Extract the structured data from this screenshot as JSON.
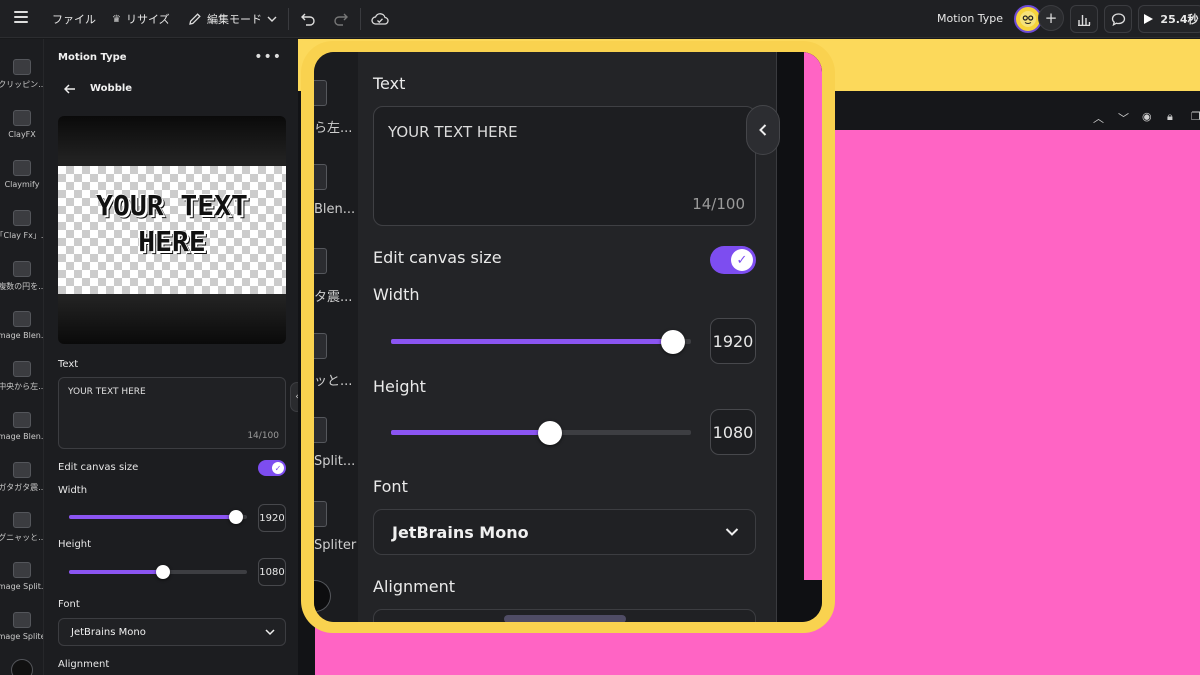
{
  "topbar": {
    "file": "ファイル",
    "resize": "リサイズ",
    "mode": "編集モード",
    "title": "Motion Type",
    "play_time": "25.4秒"
  },
  "rail": {
    "items": [
      {
        "label": "クリッピン..."
      },
      {
        "label": "ClayFX"
      },
      {
        "label": "Claymify"
      },
      {
        "label": "「Clay Fx」..."
      },
      {
        "label": "複数の円を..."
      },
      {
        "label": "Image Blen..."
      },
      {
        "label": "中央から左..."
      },
      {
        "label": "Image Blen..."
      },
      {
        "label": "ガタガタ震..."
      },
      {
        "label": "グニャッと..."
      },
      {
        "label": "Image Split..."
      },
      {
        "label": "Image Spliter"
      }
    ]
  },
  "panel": {
    "app_title": "Motion Type",
    "effect_name": "Wobble",
    "preview_text": "YOUR TEXT\nHERE",
    "text_label": "Text",
    "text_value": "YOUR TEXT HERE",
    "text_count": "14/100",
    "canvas_label": "Edit canvas size",
    "canvas_enabled": true,
    "width_label": "Width",
    "width_value": "1920",
    "width_fraction": 0.94,
    "height_label": "Height",
    "height_value": "1080",
    "height_fraction": 0.53,
    "font_label": "Font",
    "font_value": "JetBrains Mono",
    "alignment_label": "Alignment"
  },
  "inset": {
    "strip_labels": [
      "ら左...",
      "Blen...",
      "タ震...",
      "ッと...",
      "Split...",
      "Spliter"
    ],
    "text_label": "Text",
    "text_value": "YOUR TEXT HERE",
    "text_count": "14/100",
    "canvas_label": "Edit canvas size",
    "width_label": "Width",
    "width_value": "1920",
    "height_label": "Height",
    "height_value": "1080",
    "font_label": "Font",
    "font_value": "JetBrains Mono",
    "alignment_label": "Alignment"
  },
  "colors": {
    "accent": "#8b55f2",
    "highlight": "#f9d24f",
    "canvas_pink": "#ff64c4"
  }
}
